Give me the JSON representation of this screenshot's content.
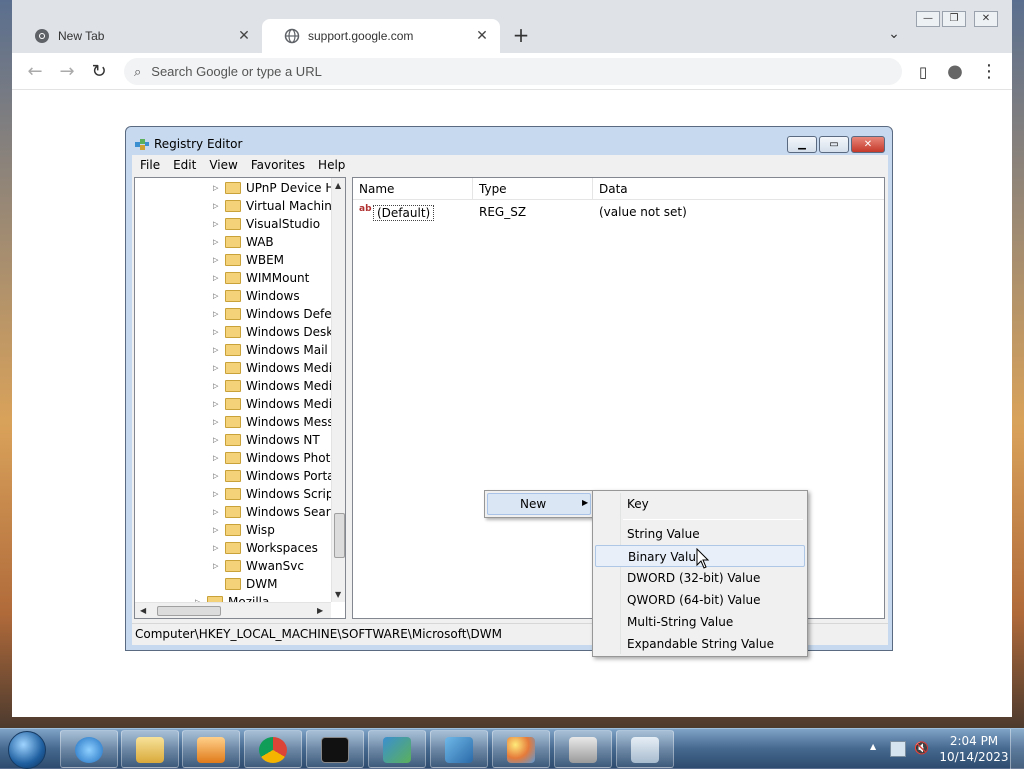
{
  "browser": {
    "tabs": [
      {
        "title": "New Tab",
        "favicon": "chrome-icon"
      },
      {
        "title": "support.google.com",
        "favicon": "globe-icon",
        "active": true
      }
    ],
    "omnibox_placeholder": "Search Google or type a URL"
  },
  "regedit": {
    "title": "Registry Editor",
    "menu": [
      "File",
      "Edit",
      "View",
      "Favorites",
      "Help"
    ],
    "tree_items": [
      "UPnP Device Ho",
      "Virtual Machine",
      "VisualStudio",
      "WAB",
      "WBEM",
      "WIMMount",
      "Windows",
      "Windows Defen",
      "Windows Deskt",
      "Windows Mail",
      "Windows Media",
      "Windows Media",
      "Windows Media",
      "Windows Messa",
      "Windows NT",
      "Windows Photo",
      "Windows Portal",
      "Windows Script",
      "Windows Search",
      "Wisp",
      "Workspaces",
      "WwanSvc",
      "DWM",
      "Mozilla"
    ],
    "columns": {
      "name": "Name",
      "type": "Type",
      "data": "Data"
    },
    "values": [
      {
        "name": "(Default)",
        "type": "REG_SZ",
        "data": "(value not set)"
      }
    ],
    "status": "Computer\\HKEY_LOCAL_MACHINE\\SOFTWARE\\Microsoft\\DWM"
  },
  "context_menu": {
    "new_label": "New",
    "submenu": {
      "key": "Key",
      "string_value": "String Value",
      "binary_value": "Binary Value",
      "dword_value": "DWORD (32-bit) Value",
      "qword_value": "QWORD (64-bit) Value",
      "multi_string_value": "Multi-String Value",
      "expandable_string_value": "Expandable String Value"
    },
    "highlighted": "Binary Value"
  },
  "taskbar": {
    "pinned": [
      "internet-explorer-icon",
      "file-explorer-icon",
      "media-player-icon",
      "chrome-icon",
      "cmd-icon",
      "registry-icon",
      "visual-studio-icon",
      "paint-icon",
      "fax-scan-icon",
      "calculator-icon"
    ],
    "time": "2:04 PM",
    "date": "10/14/2023"
  },
  "colors": {
    "chrome_tabstrip": "#dfe3e8",
    "regedit_frame": "#c7d9ee",
    "menu_highlight": "#e8eff8",
    "close_button": "#c4392a",
    "taskbar": "#46698f"
  }
}
